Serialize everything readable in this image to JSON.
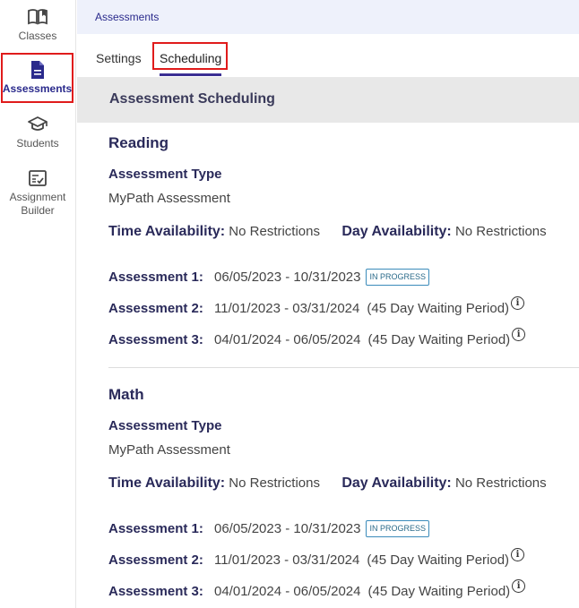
{
  "sidebar": {
    "items": [
      {
        "label": "Classes",
        "icon": "open-book-icon"
      },
      {
        "label": "Assessments",
        "icon": "document-icon"
      },
      {
        "label": "Students",
        "icon": "graduation-cap-icon"
      },
      {
        "label": "Assignment\nBuilder",
        "icon": "checklist-icon"
      }
    ]
  },
  "header": {
    "title": "Assessments"
  },
  "tabs": [
    {
      "label": "Settings"
    },
    {
      "label": "Scheduling"
    }
  ],
  "banner": {
    "title": "Assessment Scheduling"
  },
  "subjects": [
    {
      "name": "Reading",
      "type_label": "Assessment Type",
      "type_value": "MyPath Assessment",
      "time_label": "Time Availability:",
      "time_value": "No Restrictions",
      "day_label": "Day Availability:",
      "day_value": "No Restrictions",
      "assessments": [
        {
          "label": "Assessment 1:",
          "dates": "06/05/2023 - 10/31/2023",
          "badge": "IN PROGRESS"
        },
        {
          "label": "Assessment 2:",
          "dates": "11/01/2023 - 03/31/2024",
          "wait": "(45 Day Waiting Period)"
        },
        {
          "label": "Assessment 3:",
          "dates": "04/01/2024 - 06/05/2024",
          "wait": "(45 Day Waiting Period)"
        }
      ]
    },
    {
      "name": "Math",
      "type_label": "Assessment Type",
      "type_value": "MyPath Assessment",
      "time_label": "Time Availability:",
      "time_value": "No Restrictions",
      "day_label": "Day Availability:",
      "day_value": "No Restrictions",
      "assessments": [
        {
          "label": "Assessment 1:",
          "dates": "06/05/2023 - 10/31/2023",
          "badge": "IN PROGRESS"
        },
        {
          "label": "Assessment 2:",
          "dates": "11/01/2023 - 03/31/2024",
          "wait": "(45 Day Waiting Period)"
        },
        {
          "label": "Assessment 3:",
          "dates": "04/01/2024 - 06/05/2024",
          "wait": "(45 Day Waiting Period)"
        }
      ]
    }
  ],
  "colors": {
    "accent": "#3b2f94",
    "highlight": "#e01b1b",
    "topbar": "#eef1fb",
    "banner": "#e8e8e8"
  }
}
